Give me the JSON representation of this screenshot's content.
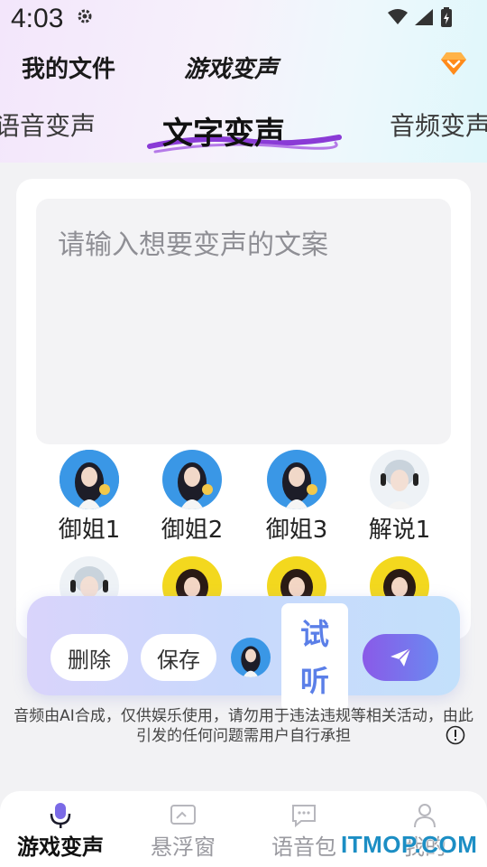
{
  "status_bar": {
    "time": "4:03"
  },
  "header": {
    "my_files": "我的文件",
    "title": "游戏变声"
  },
  "tabs": {
    "left": "语音变声",
    "center": "文字变声",
    "right": "音频变声"
  },
  "editor": {
    "placeholder": "请输入想要变声的文案"
  },
  "voices": [
    {
      "label": "御姐1"
    },
    {
      "label": "御姐2"
    },
    {
      "label": "御姐3"
    },
    {
      "label": "解说1"
    }
  ],
  "action_bar": {
    "delete_label": "删除",
    "save_label": "保存",
    "listen_label_1": "试",
    "listen_label_2": "听"
  },
  "disclaimer": {
    "line1": "音频由AI合成，仅供娱乐使用，请勿用于违法违规等相关活动，由此",
    "line2": "引发的任何问题需用户自行承担"
  },
  "bottom_nav": [
    {
      "label": "游戏变声",
      "active": true
    },
    {
      "label": "悬浮窗",
      "active": false
    },
    {
      "label": "语音包",
      "active": false
    },
    {
      "label": "我的",
      "active": false
    }
  ],
  "watermark": "ITMOP.COM",
  "colors": {
    "accent_blue": "#5b7fe8",
    "send_gradient_start": "#8a5ae8",
    "send_gradient_end": "#6b88f0",
    "watermark": "#1c8ec4"
  },
  "icons": [
    "gear-icon",
    "wifi-icon",
    "signal-icon",
    "battery-icon",
    "diamond-vip-icon",
    "send-icon",
    "info-icon",
    "microphone-icon",
    "floating-window-icon",
    "voice-pack-icon",
    "profile-icon"
  ]
}
